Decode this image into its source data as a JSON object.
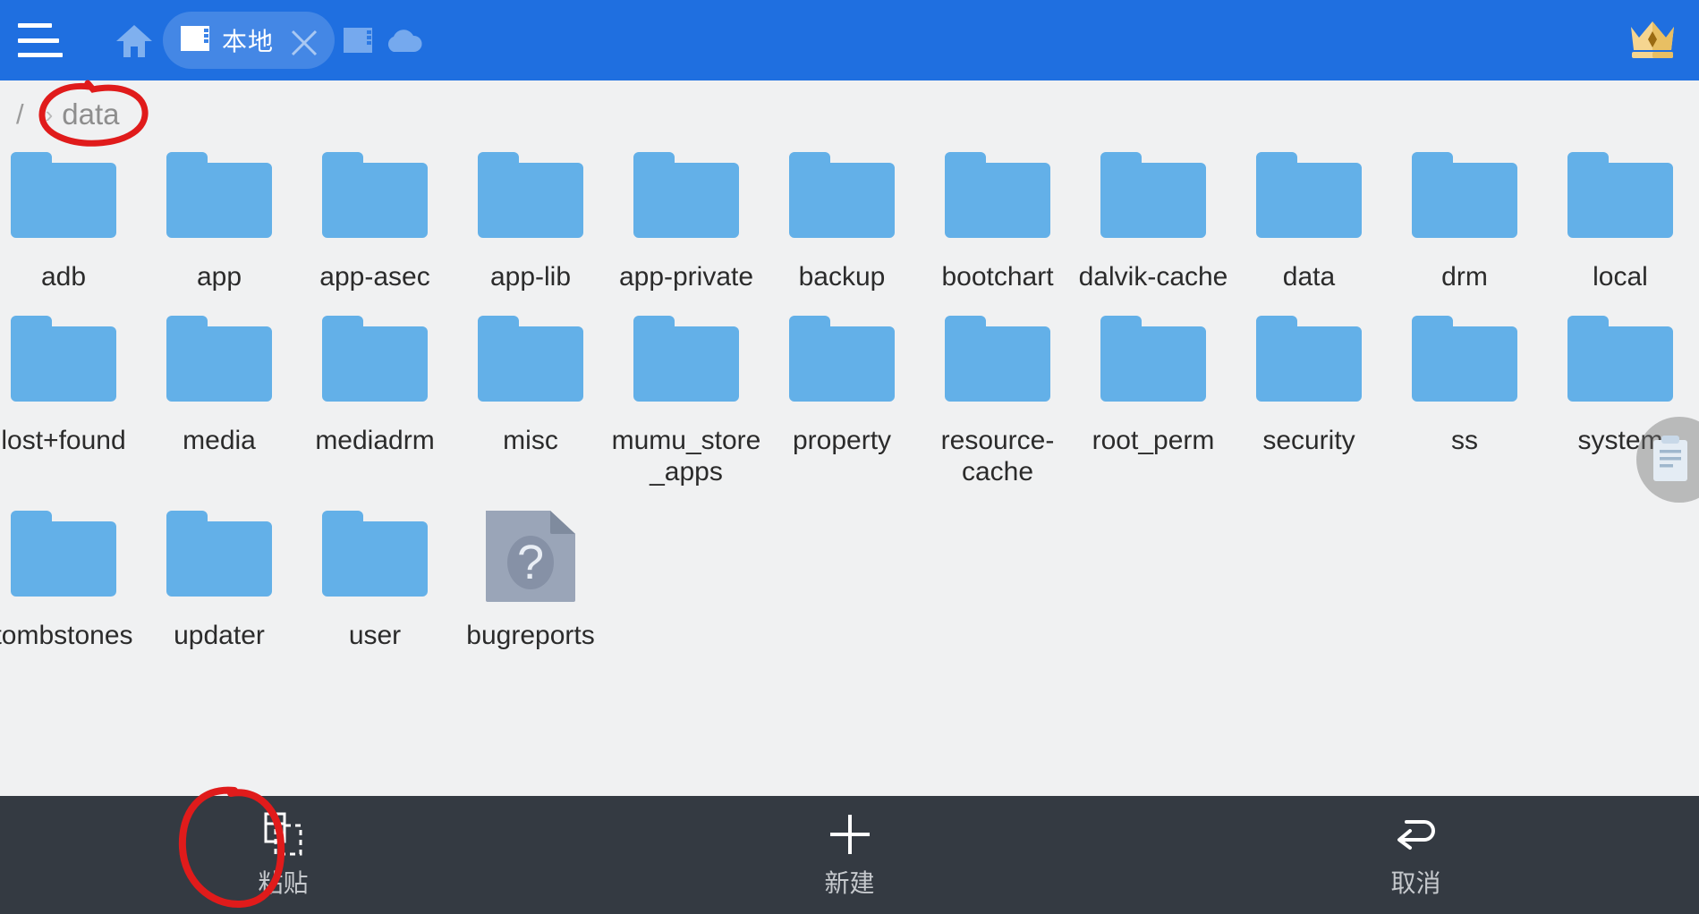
{
  "colors": {
    "appbar": "#1f6fe0",
    "page_bg": "#f0f1f2",
    "folder": "#63b0e8",
    "file_grey": "#9aa5b8",
    "bottombar": "#343a42",
    "annotation": "#e01b1b",
    "crown_gold": "#f3d07a"
  },
  "appbar": {
    "menu_icon": "hamburger-menu-icon",
    "home_icon": "home-icon",
    "sd_icon": "sd-card-icon",
    "cloud_icon": "cloud-icon",
    "crown_icon": "crown-vip-icon",
    "tab": {
      "label": "本地",
      "icon": "sd-card-icon",
      "close_icon": "close-icon"
    }
  },
  "breadcrumb": {
    "root": "/",
    "separator": "›",
    "current": "data"
  },
  "items": [
    [
      {
        "name": "adb",
        "type": "folder"
      },
      {
        "name": "app",
        "type": "folder"
      },
      {
        "name": "app-asec",
        "type": "folder"
      },
      {
        "name": "app-lib",
        "type": "folder"
      },
      {
        "name": "app-private",
        "type": "folder"
      },
      {
        "name": "backup",
        "type": "folder"
      },
      {
        "name": "bootchart",
        "type": "folder"
      },
      {
        "name": "dalvik-cache",
        "type": "folder"
      },
      {
        "name": "data",
        "type": "folder"
      },
      {
        "name": "drm",
        "type": "folder"
      },
      {
        "name": "local",
        "type": "folder"
      }
    ],
    [
      {
        "name": "lost+found",
        "type": "folder"
      },
      {
        "name": "media",
        "type": "folder"
      },
      {
        "name": "mediadrm",
        "type": "folder"
      },
      {
        "name": "misc",
        "type": "folder"
      },
      {
        "name": "mumu_store_apps",
        "type": "folder"
      },
      {
        "name": "property",
        "type": "folder"
      },
      {
        "name": "resource-cache",
        "type": "folder"
      },
      {
        "name": "root_perm",
        "type": "folder"
      },
      {
        "name": "security",
        "type": "folder"
      },
      {
        "name": "ss",
        "type": "folder"
      },
      {
        "name": "system",
        "type": "folder"
      }
    ],
    [
      {
        "name": "tombstones",
        "type": "folder"
      },
      {
        "name": "updater",
        "type": "folder"
      },
      {
        "name": "user",
        "type": "folder"
      },
      {
        "name": "bugreports",
        "type": "unknown-file"
      }
    ]
  ],
  "floating": {
    "clipboard_icon": "clipboard-icon"
  },
  "bottombar": {
    "buttons": [
      {
        "label": "粘贴",
        "icon": "paste-icon"
      },
      {
        "label": "新建",
        "icon": "plus-icon"
      },
      {
        "label": "取消",
        "icon": "undo-arrow-icon"
      }
    ]
  },
  "annotations": [
    {
      "target": "breadcrumb-data",
      "shape": "hand-drawn-circle",
      "color": "#e01b1b"
    },
    {
      "target": "paste-button",
      "shape": "hand-drawn-circle",
      "color": "#e01b1b"
    }
  ]
}
